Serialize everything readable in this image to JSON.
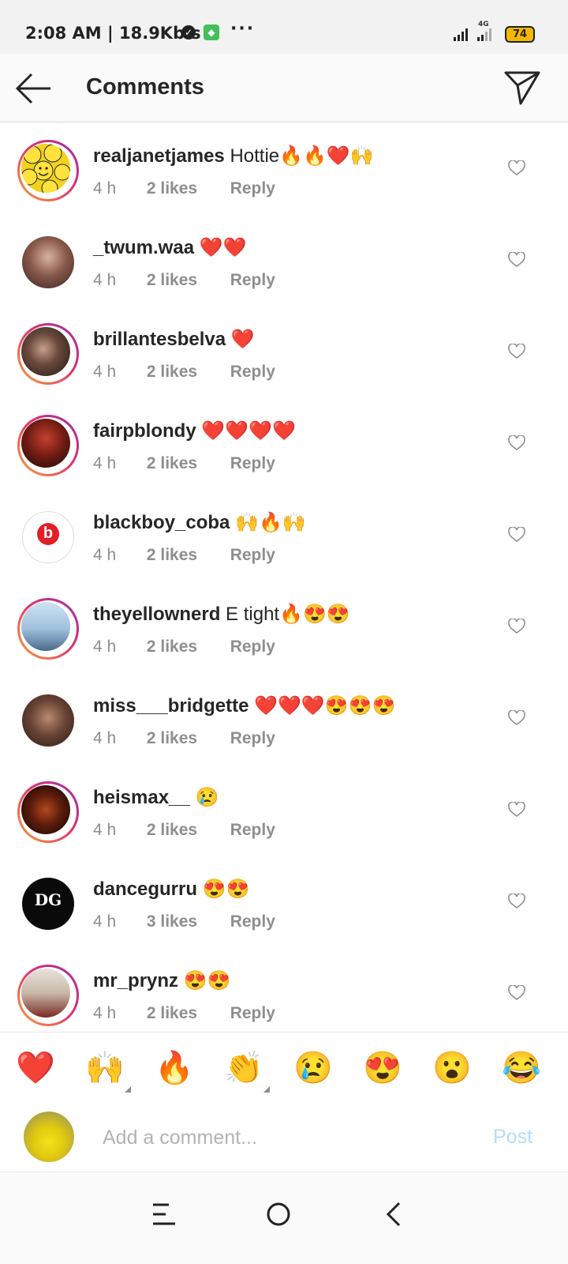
{
  "status_bar": {
    "time_speed": "2:08 AM | 18.9Kb.s",
    "network": "4G",
    "battery": "74"
  },
  "header": {
    "title": "Comments",
    "back_icon": "arrow-left-icon",
    "direct_icon": "paper-plane-icon"
  },
  "comments": [
    {
      "username": "realjanetjames",
      "text": "Hottie🔥🔥❤️🙌",
      "time": "4 h",
      "likes": "2 likes",
      "reply": "Reply",
      "story_ring": true
    },
    {
      "username": "_twum.waa",
      "text": "❤️❤️",
      "time": "4 h",
      "likes": "2 likes",
      "reply": "Reply",
      "story_ring": false
    },
    {
      "username": "brillantesbelva",
      "text": "❤️",
      "time": "4 h",
      "likes": "2 likes",
      "reply": "Reply",
      "story_ring": true
    },
    {
      "username": "fairpblondy",
      "text": "❤️❤️❤️❤️",
      "time": "4 h",
      "likes": "2 likes",
      "reply": "Reply",
      "story_ring": true
    },
    {
      "username": "blackboy_coba",
      "text": "🙌🔥🙌",
      "time": "4 h",
      "likes": "2 likes",
      "reply": "Reply",
      "story_ring": false
    },
    {
      "username": "theyellownerd",
      "text": "E tight🔥😍😍",
      "time": "4 h",
      "likes": "2 likes",
      "reply": "Reply",
      "story_ring": true
    },
    {
      "username": "miss___bridgette",
      "text": "❤️❤️❤️😍😍😍",
      "time": "4 h",
      "likes": "2 likes",
      "reply": "Reply",
      "story_ring": false
    },
    {
      "username": "heismax__",
      "text": "😢",
      "time": "4 h",
      "likes": "2 likes",
      "reply": "Reply",
      "story_ring": true
    },
    {
      "username": "dancegurru",
      "text": "😍😍",
      "time": "4 h",
      "likes": "3 likes",
      "reply": "Reply",
      "story_ring": false
    },
    {
      "username": "mr_prynz",
      "text": "😍😍",
      "time": "4 h",
      "likes": "2 likes",
      "reply": "Reply",
      "story_ring": true
    }
  ],
  "avatar_text": {
    "blackboy_coba": "b",
    "dancegurru": "DG"
  },
  "quick_emojis": [
    "❤️",
    "🙌",
    "🔥",
    "👏",
    "😢",
    "😍",
    "😮",
    "😂"
  ],
  "composer": {
    "placeholder": "Add a comment...",
    "post_label": "Post"
  },
  "colors": {
    "accent_post_disabled": "#b3dcfb",
    "meta_text": "#8e8e8e",
    "story_ring_start": "#f9a33a",
    "story_ring_end": "#9b2dae"
  }
}
